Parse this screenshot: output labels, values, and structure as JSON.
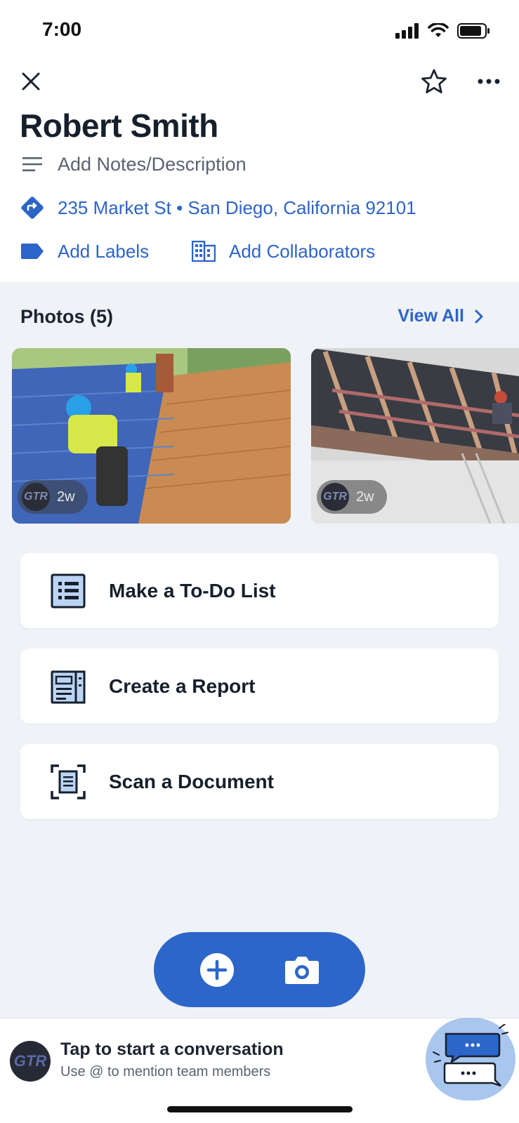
{
  "status": {
    "time": "7:00"
  },
  "header": {
    "title": "Robert Smith",
    "notes_placeholder": "Add Notes/Description",
    "address": "235 Market St • San Diego, California 92101",
    "add_labels": "Add Labels",
    "add_collaborators": "Add Collaborators"
  },
  "photos": {
    "title": "Photos (5)",
    "view_all": "View All",
    "items": [
      {
        "badge_logo": "GTR",
        "age": "2w"
      },
      {
        "badge_logo": "GTR",
        "age": "2w"
      }
    ]
  },
  "actions": [
    {
      "label": "Make a To-Do List",
      "icon": "checklist-icon"
    },
    {
      "label": "Create a Report",
      "icon": "report-icon"
    },
    {
      "label": "Scan a Document",
      "icon": "scan-document-icon"
    }
  ],
  "conversation": {
    "avatar_text": "GTR",
    "title": "Tap to start a conversation",
    "subtitle": "Use @ to mention team members"
  },
  "colors": {
    "accent": "#2d66c9",
    "background": "#eff2f6",
    "link": "#2d64c8"
  }
}
